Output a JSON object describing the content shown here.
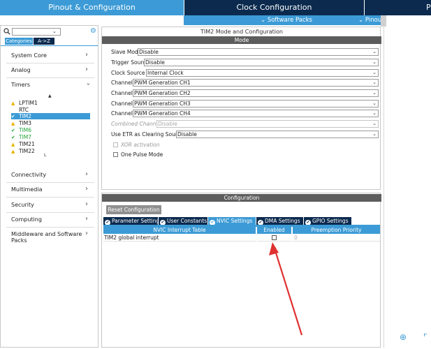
{
  "top_tabs": [
    {
      "label": "Pinout & Configuration"
    },
    {
      "label": "Clock Configuration"
    },
    {
      "label": "P"
    }
  ],
  "menus": [
    {
      "label": "Software Packs"
    },
    {
      "label": "Pinout"
    }
  ],
  "sidebar": {
    "search_value": "",
    "view_tabs": [
      "Categories",
      "A->Z"
    ],
    "categories_top": [
      "System Core",
      "Analog",
      "Timers"
    ],
    "peripherals": [
      {
        "label": "LPTIM1",
        "status": "warning"
      },
      {
        "label": "RTC",
        "status": "none"
      },
      {
        "label": "TIM2",
        "status": "enabled",
        "selected": true
      },
      {
        "label": "TIM3",
        "status": "warning"
      },
      {
        "label": "TIM6",
        "status": "ok"
      },
      {
        "label": "TIM7",
        "status": "ok"
      },
      {
        "label": "TIM21",
        "status": "warning"
      },
      {
        "label": "TIM22",
        "status": "warning"
      }
    ],
    "categories_bottom": [
      "Connectivity",
      "Multimedia",
      "Security",
      "Computing",
      "Middleware and Software Packs"
    ]
  },
  "mode_panel": {
    "title": "TIM2 Mode and Configuration",
    "header": "Mode",
    "fields": [
      {
        "label": "Slave Mode",
        "value": "Disable"
      },
      {
        "label": "Trigger Source",
        "value": "Disable"
      },
      {
        "label": "Clock Source",
        "value": "Internal Clock"
      },
      {
        "label": "Channel1",
        "value": "PWM Generation CH1"
      },
      {
        "label": "Channel2",
        "value": "PWM Generation CH2"
      },
      {
        "label": "Channel3",
        "value": "PWM Generation CH3"
      },
      {
        "label": "Channel4",
        "value": "PWM Generation CH4"
      },
      {
        "label": "Combined Channels",
        "value": "Disable"
      },
      {
        "label": "Use ETR as Clearing Source",
        "value": "Disable"
      }
    ],
    "checkboxes": [
      {
        "label": "XOR activation",
        "checked": false
      },
      {
        "label": "One Pulse Mode",
        "checked": false
      }
    ]
  },
  "config_panel": {
    "header": "Configuration",
    "reset_button": "Reset Configuration",
    "tabs": [
      "Parameter Settings",
      "User Constants",
      "NVIC Settings",
      "DMA Settings",
      "GPIO Settings"
    ],
    "active_tab": "NVIC Settings",
    "table": {
      "columns": [
        "NVIC Interrupt Table",
        "Enabled",
        "Preemption Priority"
      ],
      "rows": [
        {
          "name": "TIM2 global interrupt",
          "enabled": false,
          "priority": "0"
        }
      ]
    }
  },
  "right_panel": {
    "label": "L"
  },
  "colors": {
    "accent": "#3c9bd6",
    "navy": "#0b2a4e",
    "arrow": "#e03131"
  }
}
